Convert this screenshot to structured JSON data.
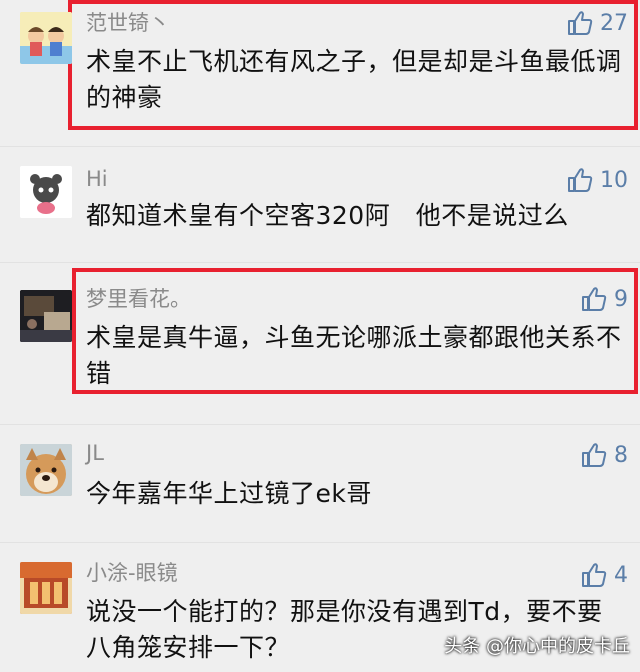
{
  "comments": [
    {
      "name": "范世锜丶",
      "text": "术皇不止飞机还有风之子，但是却是斗鱼最低调的神豪",
      "likes": "27",
      "highlighted": true
    },
    {
      "name": "Hi",
      "text": "都知道术皇有个空客320阿　他不是说过么",
      "likes": "10",
      "highlighted": false
    },
    {
      "name": "梦里看花。",
      "text": "术皇是真牛逼，斗鱼无论哪派土豪都跟他关系不错",
      "likes": "9",
      "highlighted": true
    },
    {
      "name": "JL",
      "text": "今年嘉年华上过镜了ek哥",
      "likes": "8",
      "highlighted": false
    },
    {
      "name": "小涂-眼镜",
      "text": "说没一个能打的？那是你没有遇到Td，要不要八角笼安排一下？",
      "likes": "4",
      "highlighted": false
    }
  ],
  "icons": {
    "like": "thumbs-up-icon"
  },
  "colors": {
    "highlight": "#e8202f",
    "like": "#5b7ea8"
  },
  "watermark": "头条 @你心中的皮卡丘"
}
